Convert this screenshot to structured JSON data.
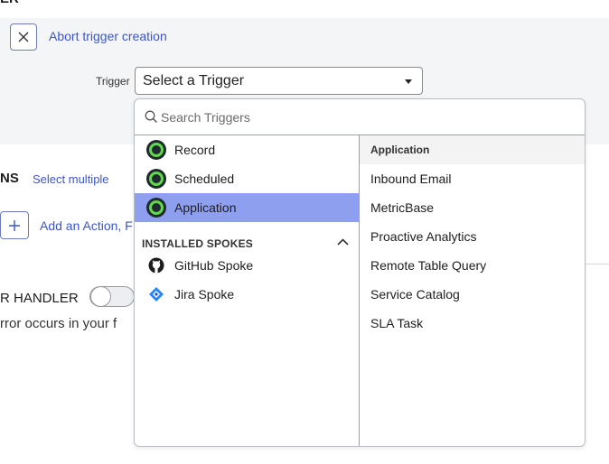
{
  "page": {
    "top_cut_label": "ER"
  },
  "trigger_panel": {
    "abort_label": "Abort trigger creation",
    "trigger_field_label": "Trigger",
    "trigger_select_value": "Select a Trigger"
  },
  "actions_section": {
    "title_fragment": "NS",
    "select_multiple": "Select multiple",
    "add_action_label": "Add an Action, F"
  },
  "error_handler": {
    "title_fragment": "R HANDLER",
    "description_fragment": "rror occurs in your f",
    "toggle_on": false
  },
  "dropdown": {
    "search_placeholder": "Search Triggers",
    "triggers": [
      {
        "label": "Record",
        "selected": false
      },
      {
        "label": "Scheduled",
        "selected": false
      },
      {
        "label": "Application",
        "selected": true
      }
    ],
    "spokes_header": "INSTALLED SPOKES",
    "spokes": [
      {
        "label": "GitHub Spoke",
        "icon": "github-icon"
      },
      {
        "label": "Jira Spoke",
        "icon": "jira-icon"
      }
    ],
    "right_header": "Application",
    "application_items": [
      "Inbound Email",
      "MetricBase",
      "Proactive Analytics",
      "Remote Table Query",
      "Service Catalog",
      "SLA Task"
    ]
  },
  "colors": {
    "accent_link": "#3b57c4",
    "selected_row": "#8e9ff0",
    "trigger_icon_green": "#62d84e"
  }
}
